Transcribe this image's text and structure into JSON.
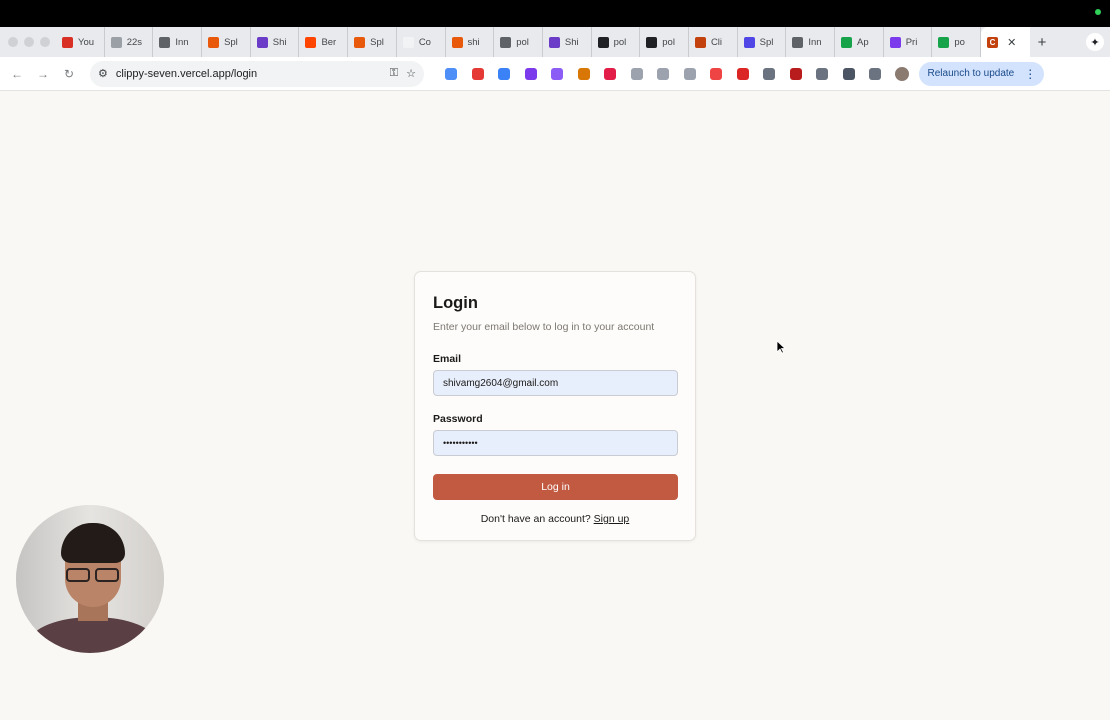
{
  "browser": {
    "tabs": [
      {
        "label": "You",
        "icon": "gmail-icon",
        "color": "#d93025"
      },
      {
        "label": "22s",
        "icon": "github-icon",
        "color": "#9aa0a6"
      },
      {
        "label": "Inn",
        "icon": "link-icon",
        "color": "#5f6368"
      },
      {
        "label": "Spl",
        "icon": "s-icon",
        "color": "#e8590c"
      },
      {
        "label": "Shi",
        "icon": "app-icon",
        "color": "#6a3cc8"
      },
      {
        "label": "Ber",
        "icon": "reddit-icon",
        "color": "#ff4500"
      },
      {
        "label": "Spl",
        "icon": "s-icon",
        "color": "#e8590c"
      },
      {
        "label": "Co",
        "icon": "blank-icon",
        "color": "#f1f3f4"
      },
      {
        "label": "shi",
        "icon": "s-icon",
        "color": "#e8590c"
      },
      {
        "label": "pol",
        "icon": "globe-icon",
        "color": "#5f6368"
      },
      {
        "label": "Shi",
        "icon": "app-icon",
        "color": "#6a3cc8"
      },
      {
        "label": "pol",
        "icon": "circle-icon",
        "color": "#202124"
      },
      {
        "label": "pol",
        "icon": "circle-icon",
        "color": "#202124"
      },
      {
        "label": "Cli",
        "icon": "c-icon",
        "color": "#c2410c"
      },
      {
        "label": "Spl",
        "icon": "gear-icon",
        "color": "#4f46e5"
      },
      {
        "label": "Inn",
        "icon": "link-icon",
        "color": "#5f6368"
      },
      {
        "label": "Ap",
        "icon": "chart-icon",
        "color": "#16a34a"
      },
      {
        "label": "Pri",
        "icon": "app-icon",
        "color": "#7c3aed"
      },
      {
        "label": "po",
        "icon": "sheet-icon",
        "color": "#16a34a"
      }
    ],
    "active_tab": {
      "label": "C",
      "icon": "c-icon",
      "color": "#c2410c"
    },
    "url": "clippy-seven.vercel.app/login",
    "relaunch_label": "Relaunch to update",
    "extensions": [
      "#4d8ef7",
      "#e53935",
      "#3b82f6",
      "#7c3aed",
      "#8b5cf6",
      "#d97706",
      "#e11d48",
      "#9ca3af",
      "#9ca3af",
      "#9ca3af",
      "#ef4444",
      "#dc2626",
      "#6b7280",
      "#b91c1c",
      "#6b7280",
      "#4b5563",
      "#6b7280"
    ]
  },
  "login": {
    "title": "Login",
    "subtitle": "Enter your email below to log in to your account",
    "email_label": "Email",
    "email_value": "shivamg2604@gmail.com",
    "password_label": "Password",
    "password_value": "•••••••••••",
    "submit_label": "Log in",
    "signup_prompt": "Don't have an account?",
    "signup_link": "Sign up"
  }
}
